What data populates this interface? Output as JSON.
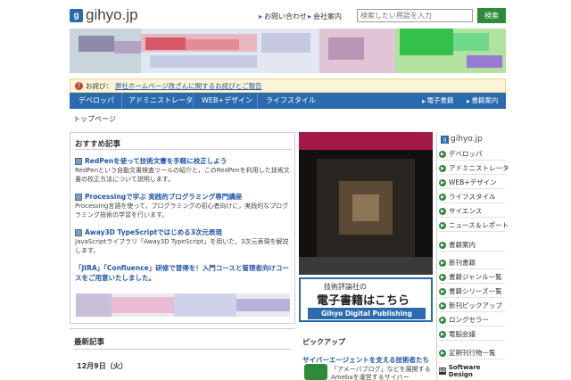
{
  "header": {
    "logo_text": "gihyo.jp",
    "links": [
      "お問い合わせ",
      "会社案内"
    ],
    "search_placeholder": "検索したい用語を入力",
    "search_button": "検索"
  },
  "notice": {
    "label": "お詫び：",
    "text": "弊社ホームページ改ざんに関するお詫びとご報告"
  },
  "nav": {
    "items": [
      "デベロッパ",
      "アドミニストレータ",
      "WEB+デザイン",
      "ライフスタイル"
    ],
    "right_items": [
      "電子書籍",
      "書籍案内"
    ]
  },
  "breadcrumb": "トップページ",
  "recommend": {
    "title": "おすすめ記事",
    "articles": [
      {
        "title": "RedPenを使って技術文書を手軽に校正しよう",
        "desc": "RedPenという自動文書検査ツールの紹介と，このRedPenを利用した技術文書の校正方法について説明します。"
      },
      {
        "title": "Processingで学ぶ 実践的プログラミング専門講座",
        "desc": "Processing言語を使って，プログラミングの初心者向けに，実践的なプログラミング技術の学習を行います。"
      },
      {
        "title": "Away3D TypeScriptではじめる3次元表現",
        "desc": "JavaScriptライブラリ「Away3D TypeScript」を用いた，3次元表現を解説します。"
      }
    ],
    "promo": "「JIRA」「Confluence」研修で習得を！入門コースと管理者向けコースをご用意いたしました。"
  },
  "ebook": {
    "line1": "技術評論社の",
    "line2": "電子書籍はこちら",
    "line3": "Gihyo Digital Publishing"
  },
  "sidebar": {
    "logo_text": "gihyo.jp",
    "items": [
      "デベロッパ",
      "アドミニストレータ",
      "WEB+デザイン",
      "ライフスタイル",
      "サイエンス",
      "ニュース＆レポート",
      "書籍案内",
      "新刊書籍",
      "書籍ジャンル一覧",
      "書籍シリーズ一覧",
      "新刊ピックアップ",
      "ロングセラー",
      "電脳会議",
      "定期刊行物一覧"
    ],
    "sd": "Software Design"
  },
  "latest": {
    "title": "最新記事",
    "date": "12月9日（火）"
  },
  "pickup": {
    "title": "ピックアップ",
    "link": "サイバーエージェントを支える技術者たち",
    "text": "「アメーバブログ」などを展開するAmebaを運営するサイバー"
  },
  "colors": {
    "brand": "#2a6bb0",
    "accent": "#2e8b3c",
    "link": "#2255aa"
  }
}
